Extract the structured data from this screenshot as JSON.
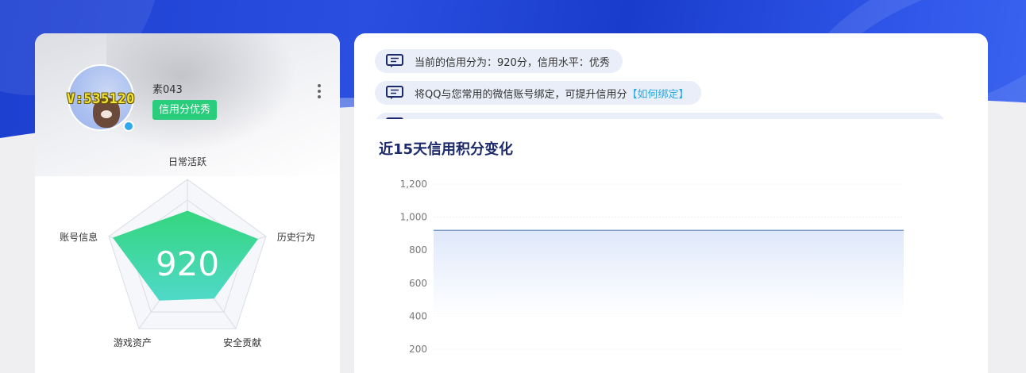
{
  "profile": {
    "vip_text": "V:535120",
    "username": "素043",
    "badge": "信用分优秀",
    "more_icon": "more-vertical-icon"
  },
  "radar": {
    "score": "920",
    "axes": [
      {
        "label": "日常活跃",
        "value": 0.62
      },
      {
        "label": "历史行为",
        "value": 0.9
      },
      {
        "label": "安全贡献",
        "value": 0.55
      },
      {
        "label": "游戏资产",
        "value": 0.58
      },
      {
        "label": "账号信息",
        "value": 0.95
      }
    ],
    "colors": {
      "fill_top": "#34d67e",
      "fill_bottom": "#4fd9c9",
      "grid": "#d9dde6"
    }
  },
  "notices": [
    {
      "icon": "message-icon",
      "text": "当前的信用分为：920分，信用水平：优秀",
      "link": ""
    },
    {
      "icon": "message-icon",
      "text": "将QQ与您常用的微信账号绑定，可提升信用分",
      "link": "【如何绑定】"
    }
  ],
  "chart_title": "近15天信用积分变化",
  "chart_data": {
    "type": "area",
    "title": "近15天信用积分变化",
    "xlabel": "",
    "ylabel": "",
    "ylim": [
      200,
      1200
    ],
    "yticks": [
      "200",
      "400",
      "600",
      "800",
      "1,000",
      "1,200"
    ],
    "series": [
      {
        "values": [
          920,
          920,
          920,
          920,
          920,
          920,
          920,
          920,
          920,
          920,
          920,
          920,
          920,
          920,
          920
        ]
      }
    ],
    "colors": {
      "line": "#7ea0c9",
      "area_top": "#dfe8fa"
    }
  }
}
